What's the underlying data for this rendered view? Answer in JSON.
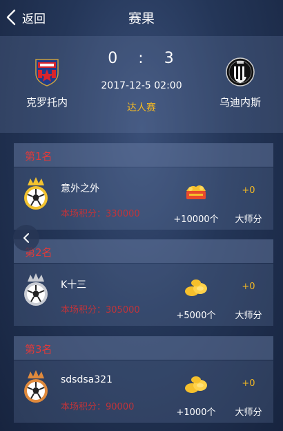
{
  "header": {
    "back_label": "返回",
    "title": "赛果"
  },
  "match": {
    "home": {
      "name": "克罗托内",
      "logo": "crotone-crest"
    },
    "away": {
      "name": "乌迪内斯",
      "logo": "udinese-crest"
    },
    "score_home": "0",
    "score_sep": ":",
    "score_away": "3",
    "datetime": "2017-12-5 02:00",
    "type": "达人赛"
  },
  "ranks": [
    {
      "rank_label": "第1名",
      "crown": "gold-crown",
      "user": "意外之外",
      "points_label": "本场积分：",
      "points": "330000",
      "reward": "+10000个",
      "reward_icon": "gold-pile-icon",
      "master_points": "+0",
      "master_label": "大师分"
    },
    {
      "rank_label": "第2名",
      "crown": "silver-crown",
      "user": "K十三",
      "points_label": "本场积分：",
      "points": "305000",
      "reward": "+5000个",
      "reward_icon": "gold-coins-icon",
      "master_points": "+0",
      "master_label": "大师分"
    },
    {
      "rank_label": "第3名",
      "crown": "bronze-crown",
      "user": "sdsdsa321",
      "points_label": "本场积分：",
      "points": "90000",
      "reward": "+1000个",
      "reward_icon": "gold-coins-icon",
      "master_points": "+0",
      "master_label": "大师分"
    }
  ],
  "colors": {
    "accent": "#f2b824",
    "rank_red": "#e03a3a",
    "points_red": "#c0343a"
  }
}
